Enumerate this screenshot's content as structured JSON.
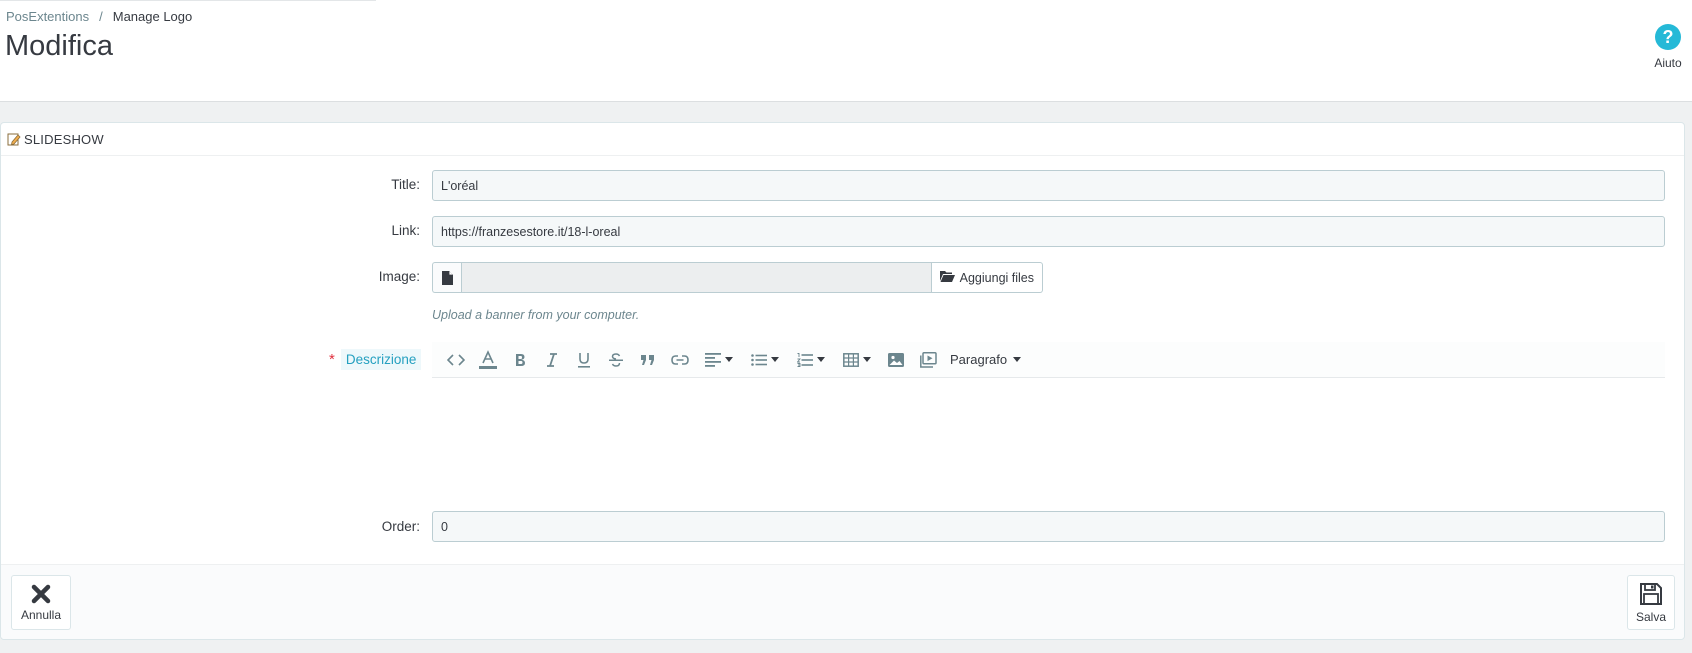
{
  "breadcrumb": {
    "parent": "PosExtentions",
    "separator": "/",
    "current": "Manage Logo"
  },
  "page": {
    "title": "Modifica"
  },
  "help": {
    "label": "Aiuto",
    "glyph": "?"
  },
  "panel": {
    "heading": "SLIDESHOW"
  },
  "form": {
    "title": {
      "label": "Title:",
      "value": "L'oréal"
    },
    "link": {
      "label": "Link:",
      "value": "https://franzesestore.it/18-l-oreal"
    },
    "image": {
      "label": "Image:",
      "button_label": "Aggiungi files",
      "help_text": "Upload a banner from your computer."
    },
    "description": {
      "label": "Descrizione",
      "required_marker": "*",
      "format_label": "Paragrafo"
    },
    "order": {
      "label": "Order:",
      "value": "0"
    }
  },
  "footer": {
    "cancel_label": "Annulla",
    "save_label": "Salva"
  },
  "colors": {
    "accent": "#25b9d7",
    "required": "#e0303e",
    "text": "#363a41",
    "muted": "#6c868e"
  }
}
